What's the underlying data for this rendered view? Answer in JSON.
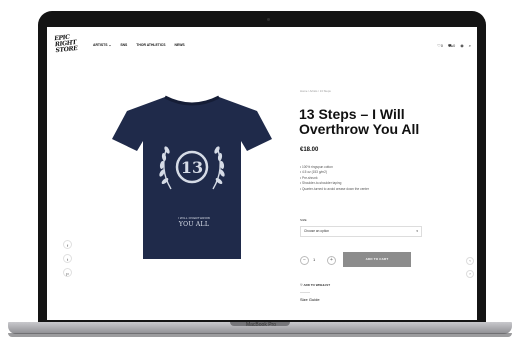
{
  "device": {
    "label": "MacBook Pro"
  },
  "header": {
    "logo_text": [
      "EPIC",
      "RIGHT",
      "STORE"
    ],
    "nav": [
      "ARTISTS",
      "SNS",
      "THOR ATHLETICS",
      "NEWS"
    ],
    "nav_artists_chevron": "⌄",
    "icons": [
      {
        "name": "wishlist-icon",
        "glyph": "♡",
        "count": "0"
      },
      {
        "name": "cart-icon",
        "glyph": "🛒",
        "count": "0"
      },
      {
        "name": "account-icon",
        "glyph": "◉"
      },
      {
        "name": "search-icon",
        "glyph": "⌕"
      }
    ]
  },
  "product": {
    "breadcrumb": "Home / Artists / 13 Steps",
    "title": "13 Steps – I Will Overthrow You All",
    "price": "€18.00",
    "features": [
      "• 100% ringspun cotton",
      "• 4.5 oz (153 g/m2)",
      "• Pre-shrunk",
      "• Shoulder-to-shoulder taping",
      "• Quarter-turned to avoid crease down the center"
    ],
    "size_label": "SIZE",
    "size_placeholder": "Choose an option",
    "quantity": "1",
    "add_to_cart": "ADD TO CART",
    "wishlist": "ADD TO WISHLIST",
    "size_guide": "Size Guide",
    "shirt_emblem_line1": "I WILL OVERTHROW",
    "shirt_emblem_line2": "YOU ALL",
    "shirt_badge": "13"
  },
  "social": [
    {
      "name": "facebook-icon",
      "glyph": "f"
    },
    {
      "name": "twitter-icon",
      "glyph": "t"
    },
    {
      "name": "pinterest-icon",
      "glyph": "p"
    }
  ],
  "colors": {
    "shirt": "#1f2a4a",
    "button": "#8c8c8c",
    "bezel": "#141414"
  }
}
